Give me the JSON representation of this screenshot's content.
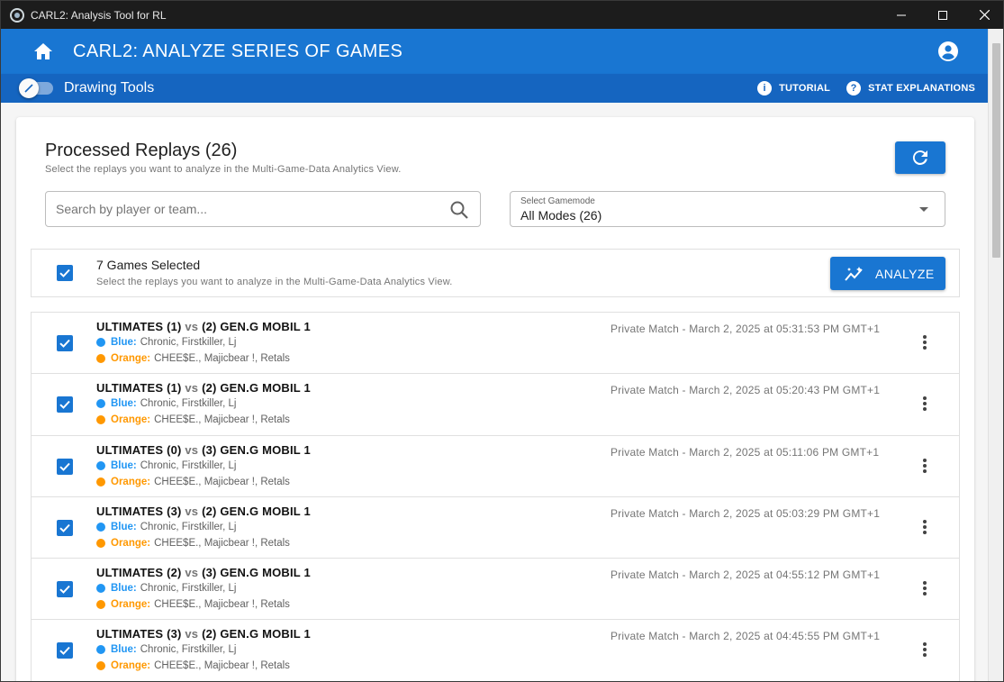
{
  "window": {
    "title": "CARL2: Analysis Tool for RL"
  },
  "appbar": {
    "title": "CARL2: ANALYZE SERIES OF GAMES"
  },
  "toolbar": {
    "drawing_tools_label": "Drawing Tools",
    "drawing_tools_enabled": false,
    "tutorial_label": "TUTORIAL",
    "stat_explanations_label": "STAT EXPLANATIONS"
  },
  "colors": {
    "primary": "#1976d2",
    "primary_dark": "#1565c0",
    "blue_team": "#2196f3",
    "orange_team": "#ff9800"
  },
  "card": {
    "title": "Processed Replays (26)",
    "subtitle": "Select the replays you want to analyze in the Multi-Game-Data Analytics View.",
    "search_placeholder": "Search by player or team...",
    "gamemode_label": "Select Gamemode",
    "gamemode_value": "All Modes (26)"
  },
  "selection": {
    "count_label": "7 Games Selected",
    "hint": "Select the replays you want to analyze in the Multi-Game-Data Analytics View.",
    "analyze_label": "ANALYZE"
  },
  "replays": [
    {
      "team1": "ULTIMATES (1)",
      "vs": "vs",
      "team2": "(2) GEN.G MOBIL 1",
      "blue_label": "Blue:",
      "blue_players": "Chronic, Firstkiller, Lj",
      "orange_label": "Orange:",
      "orange_players": "CHEE$E., Majicbear !, Retals",
      "meta": "Private Match - March 2, 2025 at 05:31:53 PM GMT+1",
      "selected": true
    },
    {
      "team1": "ULTIMATES (1)",
      "vs": "vs",
      "team2": "(2) GEN.G MOBIL 1",
      "blue_label": "Blue:",
      "blue_players": "Chronic, Firstkiller, Lj",
      "orange_label": "Orange:",
      "orange_players": "CHEE$E., Majicbear !, Retals",
      "meta": "Private Match - March 2, 2025 at 05:20:43 PM GMT+1",
      "selected": true
    },
    {
      "team1": "ULTIMATES (0)",
      "vs": "vs",
      "team2": "(3) GEN.G MOBIL 1",
      "blue_label": "Blue:",
      "blue_players": "Chronic, Firstkiller, Lj",
      "orange_label": "Orange:",
      "orange_players": "CHEE$E., Majicbear !, Retals",
      "meta": "Private Match - March 2, 2025 at 05:11:06 PM GMT+1",
      "selected": true
    },
    {
      "team1": "ULTIMATES (3)",
      "vs": "vs",
      "team2": "(2) GEN.G MOBIL 1",
      "blue_label": "Blue:",
      "blue_players": "Chronic, Firstkiller, Lj",
      "orange_label": "Orange:",
      "orange_players": "CHEE$E., Majicbear !, Retals",
      "meta": "Private Match - March 2, 2025 at 05:03:29 PM GMT+1",
      "selected": true
    },
    {
      "team1": "ULTIMATES (2)",
      "vs": "vs",
      "team2": "(3) GEN.G MOBIL 1",
      "blue_label": "Blue:",
      "blue_players": "Chronic, Firstkiller, Lj",
      "orange_label": "Orange:",
      "orange_players": "CHEE$E., Majicbear !, Retals",
      "meta": "Private Match - March 2, 2025 at 04:55:12 PM GMT+1",
      "selected": true
    },
    {
      "team1": "ULTIMATES (3)",
      "vs": "vs",
      "team2": "(2) GEN.G MOBIL 1",
      "blue_label": "Blue:",
      "blue_players": "Chronic, Firstkiller, Lj",
      "orange_label": "Orange:",
      "orange_players": "CHEE$E., Majicbear !, Retals",
      "meta": "Private Match - March 2, 2025 at 04:45:55 PM GMT+1",
      "selected": true
    }
  ]
}
